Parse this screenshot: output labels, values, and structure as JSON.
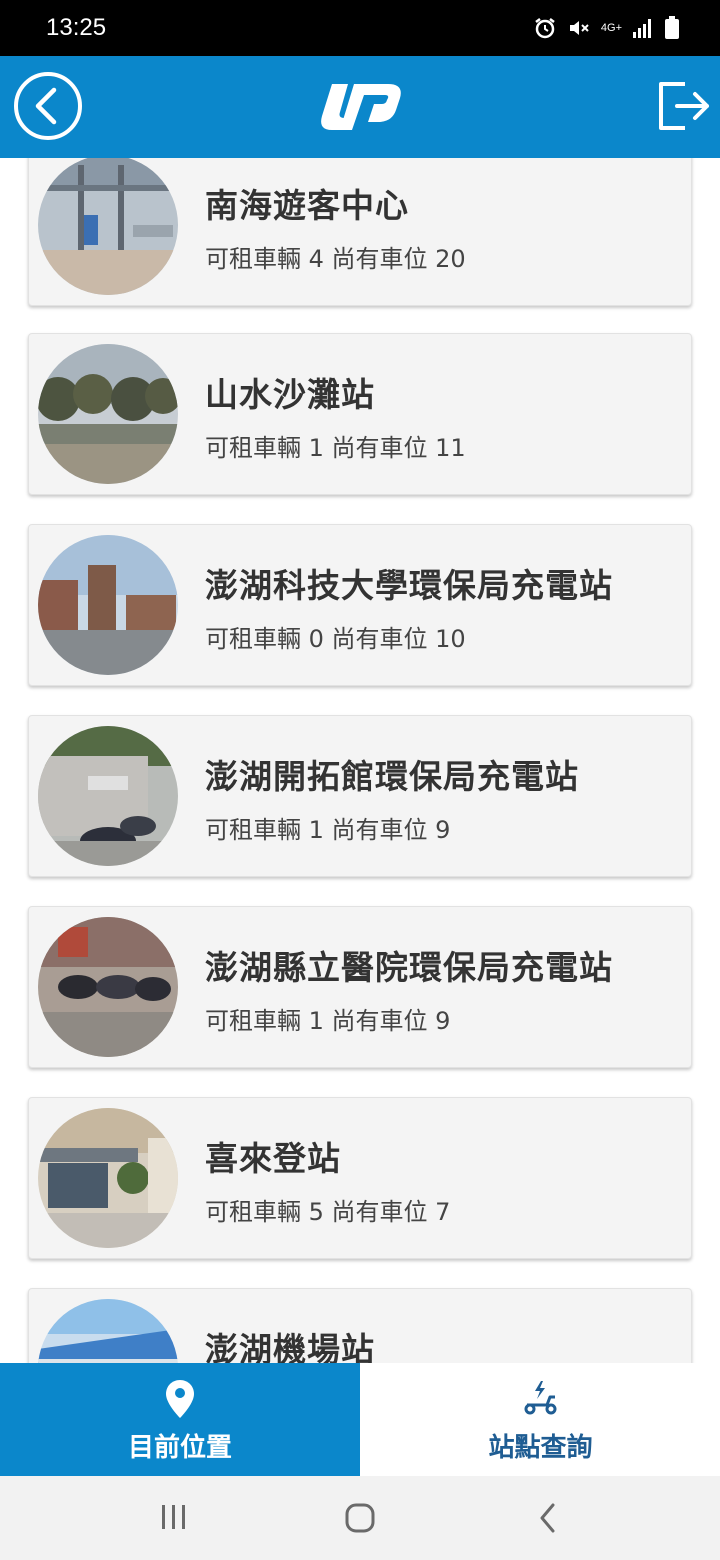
{
  "status_bar": {
    "time": "13:25",
    "network": "4G+"
  },
  "header": {
    "back_icon": "back-circle-icon",
    "logo_icon": "up-logo-icon",
    "logout_icon": "logout-icon"
  },
  "stations": [
    {
      "name": "南海遊客中心",
      "info": "可租車輛 4 尚有車位 20"
    },
    {
      "name": "山水沙灘站",
      "info": "可租車輛 1 尚有車位 11"
    },
    {
      "name": "澎湖科技大學環保局充電站",
      "info": "可租車輛 0 尚有車位 10"
    },
    {
      "name": "澎湖開拓館環保局充電站",
      "info": "可租車輛 1 尚有車位 9"
    },
    {
      "name": "澎湖縣立醫院環保局充電站",
      "info": "可租車輛 1 尚有車位 9"
    },
    {
      "name": "喜來登站",
      "info": "可租車輛 5 尚有車位 7"
    },
    {
      "name": "澎湖機場站",
      "info": ""
    }
  ],
  "bottom_nav": {
    "current_location": {
      "label": "目前位置",
      "icon": "map-pin-icon"
    },
    "station_search": {
      "label": "站點查詢",
      "icon": "scooter-charging-icon"
    }
  },
  "colors": {
    "primary": "#0b87cb",
    "nav_text": "#1f5d93",
    "card_bg": "#f4f4f4"
  }
}
